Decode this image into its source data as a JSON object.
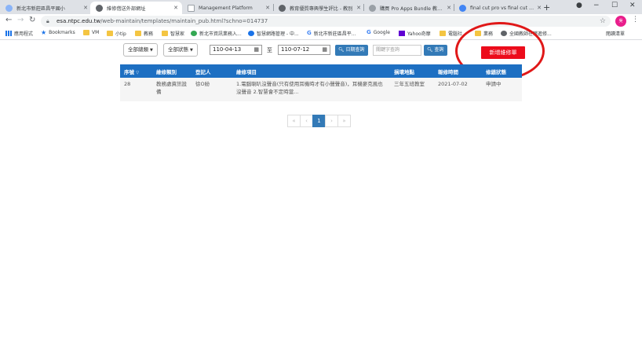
{
  "browser": {
    "tabs": [
      {
        "title": "新北市新莊區昌平國小",
        "favicon_color": "#8ab4f8",
        "active": false
      },
      {
        "title": "維修借送外部網址",
        "favicon_color": "#5f6368",
        "active": true
      },
      {
        "title": "Management Platform",
        "favicon_color": "#9aa0a6",
        "active": false
      },
      {
        "title": "教育優質專興學生評比 - 教別",
        "favicon_color": "#5f6368",
        "active": false
      },
      {
        "title": "購買 Pro Apps Bundle 教育版",
        "favicon_color": "#9aa0a6",
        "active": false
      },
      {
        "title": "final cut pro vs final cut pro",
        "favicon_color": "#4285f4",
        "active": false
      }
    ],
    "new_tab": "+",
    "window_controls": {
      "record": "●",
      "minimize": "−",
      "maximize": "☐",
      "close": "✕"
    },
    "url_host": "esa.ntpc.edu.tw",
    "url_path": "/web-maintain/templates/maintain_pub.html?schno=014737",
    "profile_initials": "吳",
    "bookmarks": [
      {
        "label": "應用程式",
        "icon": "apps-icon"
      },
      {
        "label": "Bookmarks",
        "icon": "star-icon"
      },
      {
        "label": "VM",
        "icon": "folder-icon"
      },
      {
        "label": "小tip",
        "icon": "folder-icon"
      },
      {
        "label": "教務",
        "icon": "folder-icon"
      },
      {
        "label": "智慧家",
        "icon": "folder-icon"
      },
      {
        "label": "新北市資訊業務入...",
        "icon": "leaf-icon"
      },
      {
        "label": "智慧網路管理 - 中...",
        "icon": "s-icon"
      },
      {
        "label": "新北市新莊區昌平...",
        "icon": "google-icon"
      },
      {
        "label": "Google",
        "icon": "google-icon"
      },
      {
        "label": "Yahoo奇摩",
        "icon": "yahoo-icon"
      },
      {
        "label": "電腦社",
        "icon": "folder-icon"
      },
      {
        "label": "業務",
        "icon": "folder-icon"
      },
      {
        "label": "全國教師在職進修...",
        "icon": "globe-icon"
      }
    ],
    "reading_list": "閱讀清單"
  },
  "filters": {
    "category_label": "全部總類",
    "status_label": "全部狀態",
    "date_from": "110-04-13",
    "date_to_label": "至",
    "date_to": "110-07-12",
    "date_search_label": "日期查詢",
    "keyword_placeholder": "關鍵字查詢",
    "search_label": "查詢",
    "add_label": "新增維修單"
  },
  "table": {
    "headers": [
      "序號",
      "維修類別",
      "登記人",
      "維修項目",
      "損壞地點",
      "報修時間",
      "修繕狀態"
    ],
    "rows": [
      {
        "id": "28",
        "category": "教務處資訊設備",
        "registrant": "徐O紛",
        "item": "1.電腦喇叭沒聲音(只有使用耳機時才有小聲聲音)，耳機麥克風也沒聲音 2.智慧會不定時當...",
        "location": "三年五班教室",
        "report_time": "2021-07-02",
        "status": "申請中"
      }
    ]
  },
  "pagination": {
    "first": "«",
    "prev": "‹",
    "current": "1",
    "next": "›",
    "last": "»"
  }
}
